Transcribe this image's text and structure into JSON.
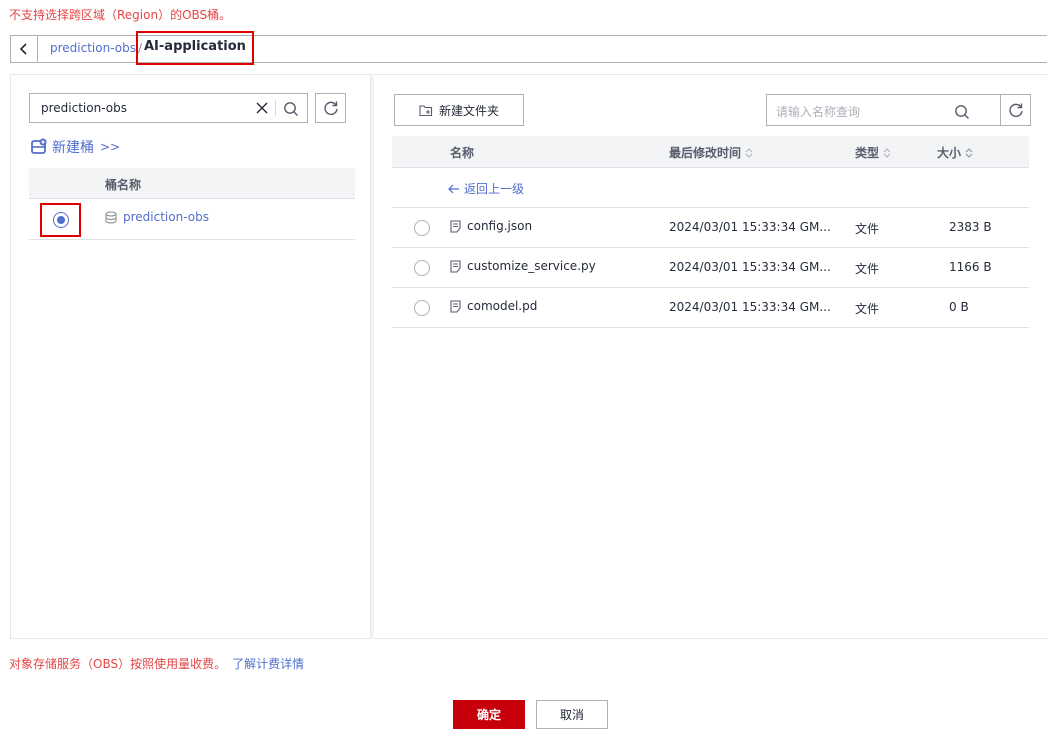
{
  "warning_top": "不支持选择跨区域（Region）的OBS桶。",
  "breadcrumb": {
    "back_icon": "chevron-left-icon",
    "root": "prediction-obs",
    "separator": "/",
    "current": "AI-application"
  },
  "left_panel": {
    "search_value": "prediction-obs",
    "new_bucket_label": "新建桶",
    "new_bucket_arrows": ">>",
    "column_bucket_name": "桶名称",
    "buckets": [
      {
        "name": "prediction-obs",
        "selected": true
      }
    ]
  },
  "right_panel": {
    "new_folder_label": "新建文件夹",
    "query_placeholder": "请输入名称查询",
    "columns": {
      "name": "名称",
      "modified": "最后修改时间",
      "type": "类型",
      "size": "大小"
    },
    "back_label": "返回上一级",
    "files": [
      {
        "name": "config.json",
        "modified": "2024/03/01 15:33:34 GM...",
        "type": "文件",
        "size": "2383 B"
      },
      {
        "name": "customize_service.py",
        "modified": "2024/03/01 15:33:34 GM...",
        "type": "文件",
        "size": "1166 B"
      },
      {
        "name": "comodel.pd",
        "modified": "2024/03/01 15:33:34 GM...",
        "type": "文件",
        "size": "0 B"
      }
    ]
  },
  "fee_note": {
    "text": "对象存储服务（OBS）按照使用量收费。",
    "link": "了解计费详情"
  },
  "actions": {
    "confirm": "确定",
    "cancel": "取消"
  },
  "colors": {
    "accent": "#526ecc",
    "danger": "#e54545",
    "primary_button": "#c7000b",
    "highlight_box": "#e00000"
  }
}
